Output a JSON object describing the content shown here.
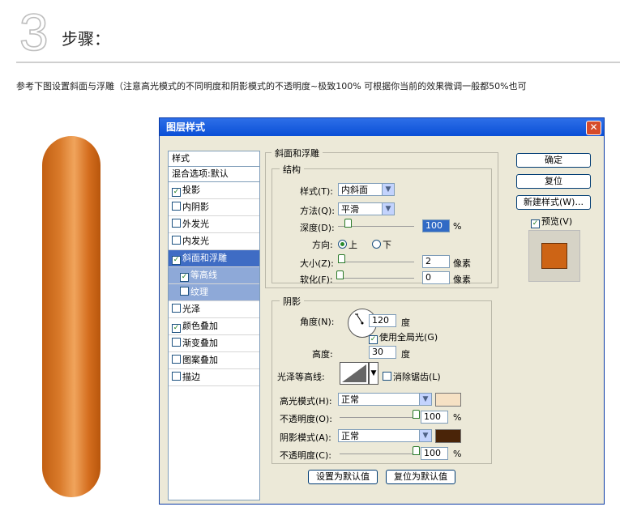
{
  "header": {
    "step_number": "3",
    "step_title": "步骤："
  },
  "intro_text": "参考下图设置斜面与浮雕（注意高光模式的不同明度和阴影模式的不透明度~极致100% 可根据你当前的效果微调一般都50%也可",
  "dialog": {
    "title": "图层样式",
    "close_label": "✕",
    "styles_header": "样式",
    "blend_item": "混合选项:默认",
    "styles": [
      {
        "label": "投影",
        "checked": true
      },
      {
        "label": "内阴影",
        "checked": false
      },
      {
        "label": "外发光",
        "checked": false
      },
      {
        "label": "内发光",
        "checked": false
      },
      {
        "label": "斜面和浮雕",
        "checked": true,
        "selected": true
      },
      {
        "label": "等高线",
        "checked": true,
        "sub": true
      },
      {
        "label": "纹理",
        "checked": false,
        "sub": true
      },
      {
        "label": "光泽",
        "checked": false
      },
      {
        "label": "颜色叠加",
        "checked": true
      },
      {
        "label": "渐变叠加",
        "checked": false
      },
      {
        "label": "图案叠加",
        "checked": false
      },
      {
        "label": "描边",
        "checked": false
      }
    ],
    "bevel": {
      "group_title": "斜面和浮雕",
      "structure_title": "结构",
      "style_label": "样式(T):",
      "style_value": "内斜面",
      "technique_label": "方法(Q):",
      "technique_value": "平滑",
      "depth_label": "深度(D):",
      "depth_value": "100",
      "percent": "%",
      "direction_label": "方向:",
      "dir_up": "上",
      "dir_down": "下",
      "size_label": "大小(Z):",
      "size_value": "2",
      "soften_label": "软化(F):",
      "soften_value": "0",
      "pixels": "像素"
    },
    "shading": {
      "group_title": "阴影",
      "angle_label": "角度(N):",
      "angle_value": "120",
      "degree": "度",
      "global_light_label": "使用全局光(G)",
      "global_light_checked": true,
      "altitude_label": "高度:",
      "altitude_value": "30",
      "gloss_label": "光泽等高线:",
      "antialias_label": "消除锯齿(L)",
      "antialias_checked": false,
      "highlight_mode_label": "高光模式(H):",
      "highlight_mode_value": "正常",
      "highlight_color": "#f6e1c4",
      "highlight_opacity_label": "不透明度(O):",
      "highlight_opacity_value": "100",
      "shadow_mode_label": "阴影模式(A):",
      "shadow_mode_value": "正常",
      "shadow_color": "#4a2408",
      "shadow_opacity_label": "不透明度(C):",
      "shadow_opacity_value": "100"
    },
    "buttons": {
      "ok": "确定",
      "reset": "复位",
      "new_style": "新建样式(W)...",
      "preview_label": "预览(V)",
      "preview_checked": true,
      "set_default": "设置为默认值",
      "reset_default": "复位为默认值"
    }
  }
}
